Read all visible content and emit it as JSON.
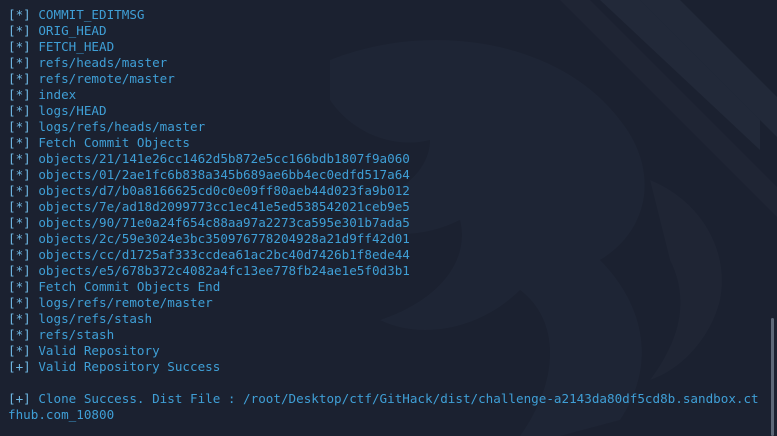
{
  "terminal": {
    "lines": [
      {
        "prefix": "[*]",
        "text": "COMMIT_EDITMSG"
      },
      {
        "prefix": "[*]",
        "text": "ORIG_HEAD"
      },
      {
        "prefix": "[*]",
        "text": "FETCH_HEAD"
      },
      {
        "prefix": "[*]",
        "text": "refs/heads/master"
      },
      {
        "prefix": "[*]",
        "text": "refs/remote/master"
      },
      {
        "prefix": "[*]",
        "text": "index"
      },
      {
        "prefix": "[*]",
        "text": "logs/HEAD"
      },
      {
        "prefix": "[*]",
        "text": "logs/refs/heads/master"
      },
      {
        "prefix": "[*]",
        "text": "Fetch Commit Objects"
      },
      {
        "prefix": "[*]",
        "text": "objects/21/141e26cc1462d5b872e5cc166bdb1807f9a060"
      },
      {
        "prefix": "[*]",
        "text": "objects/01/2ae1fc6b838a345b689ae6bb4ec0edfd517a64"
      },
      {
        "prefix": "[*]",
        "text": "objects/d7/b0a8166625cd0c0e09ff80aeb44d023fa9b012"
      },
      {
        "prefix": "[*]",
        "text": "objects/7e/ad18d2099773cc1ec41e5ed538542021ceb9e5"
      },
      {
        "prefix": "[*]",
        "text": "objects/90/71e0a24f654c88aa97a2273ca595e301b7ada5"
      },
      {
        "prefix": "[*]",
        "text": "objects/2c/59e3024e3bc350976778204928a21d9ff42d01"
      },
      {
        "prefix": "[*]",
        "text": "objects/cc/d1725af333ccdea61ac2bc40d7426b1f8ede44"
      },
      {
        "prefix": "[*]",
        "text": "objects/e5/678b372c4082a4fc13ee778fb24ae1e5f0d3b1"
      },
      {
        "prefix": "[*]",
        "text": "Fetch Commit Objects End"
      },
      {
        "prefix": "[*]",
        "text": "logs/refs/remote/master"
      },
      {
        "prefix": "[*]",
        "text": "logs/refs/stash"
      },
      {
        "prefix": "[*]",
        "text": "refs/stash"
      },
      {
        "prefix": "[*]",
        "text": "Valid Repository"
      },
      {
        "prefix": "[+]",
        "text": "Valid Repository Success"
      }
    ],
    "final": {
      "prefix": "[+]",
      "text": "Clone Success. Dist File : /root/Desktop/ctf/GitHack/dist/challenge-a2143da80df5cd8b.sandbox.ctfhub.com_10800"
    }
  },
  "colors": {
    "background": "#1b2130",
    "text": "#3f9fd6"
  }
}
